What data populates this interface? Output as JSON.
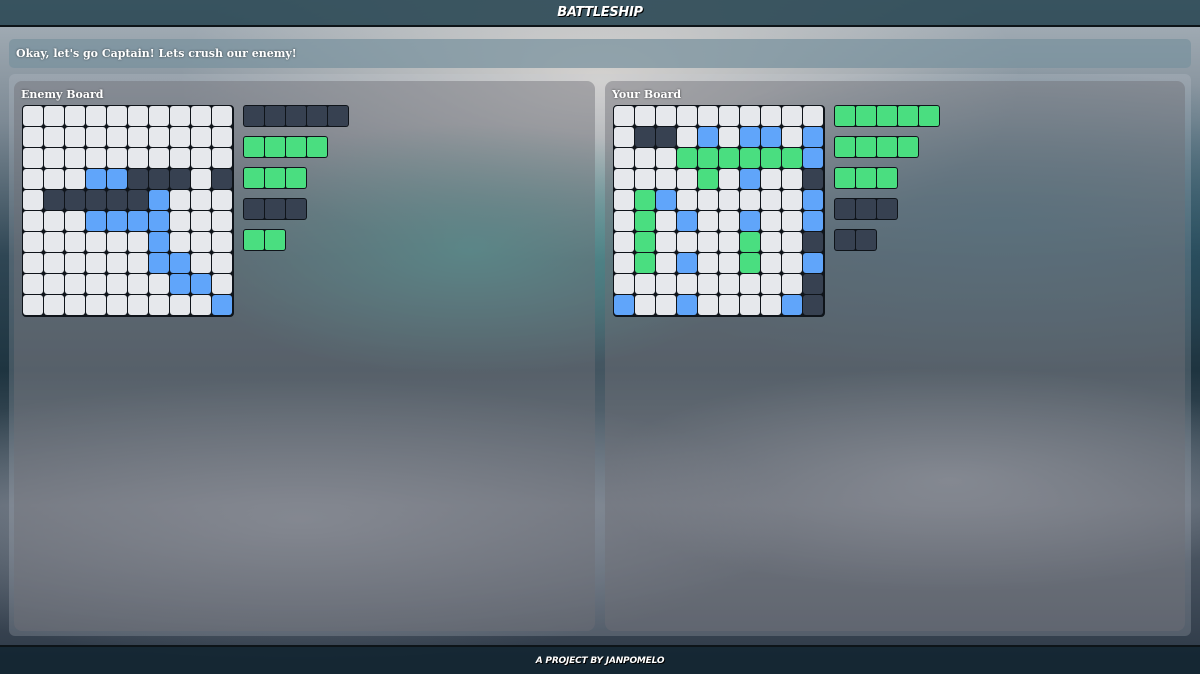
{
  "app": {
    "title": "BATTLESHIP"
  },
  "message": "Okay, let's go Captain! Lets crush our enemy!",
  "colors": {
    "empty": "#e6e8ec",
    "hit_water": "#60a5fa",
    "ship": "#374151",
    "sunk": "#4ade80"
  },
  "cell_legend": {
    "e": "empty",
    "w": "miss-water",
    "s": "ship",
    "g": "sunk-ship"
  },
  "enemy_board": {
    "title": "Enemy Board",
    "grid": [
      "eeeeeeeeee",
      "eeeeeeeeee",
      "eeeeeeeeee",
      "eeewwssses",
      "esssssweee",
      "eeewwwweee",
      "eeeeeeweee",
      "eeeeeewwee",
      "eeeeeeewwe",
      "eeeeeeeeew"
    ],
    "fleet": [
      {
        "length": 5,
        "status": "afloat"
      },
      {
        "length": 4,
        "status": "sunk"
      },
      {
        "length": 3,
        "status": "sunk"
      },
      {
        "length": 3,
        "status": "afloat"
      },
      {
        "length": 2,
        "status": "sunk"
      }
    ]
  },
  "player_board": {
    "title": "Your Board",
    "grid": [
      "eeeeeeeeee",
      "essewewwew",
      "eeeggggggw",
      "eeeegewees",
      "egweeeeeew",
      "egeweeweew",
      "egeeeegees",
      "egeweegeew",
      "eeeeeeeees",
      "weeweeeews"
    ],
    "fleet": [
      {
        "length": 5,
        "status": "sunk"
      },
      {
        "length": 4,
        "status": "sunk"
      },
      {
        "length": 3,
        "status": "sunk"
      },
      {
        "length": 3,
        "status": "afloat"
      },
      {
        "length": 2,
        "status": "afloat"
      }
    ]
  },
  "footer": {
    "text": "A PROJECT BY JANPOMELO"
  }
}
